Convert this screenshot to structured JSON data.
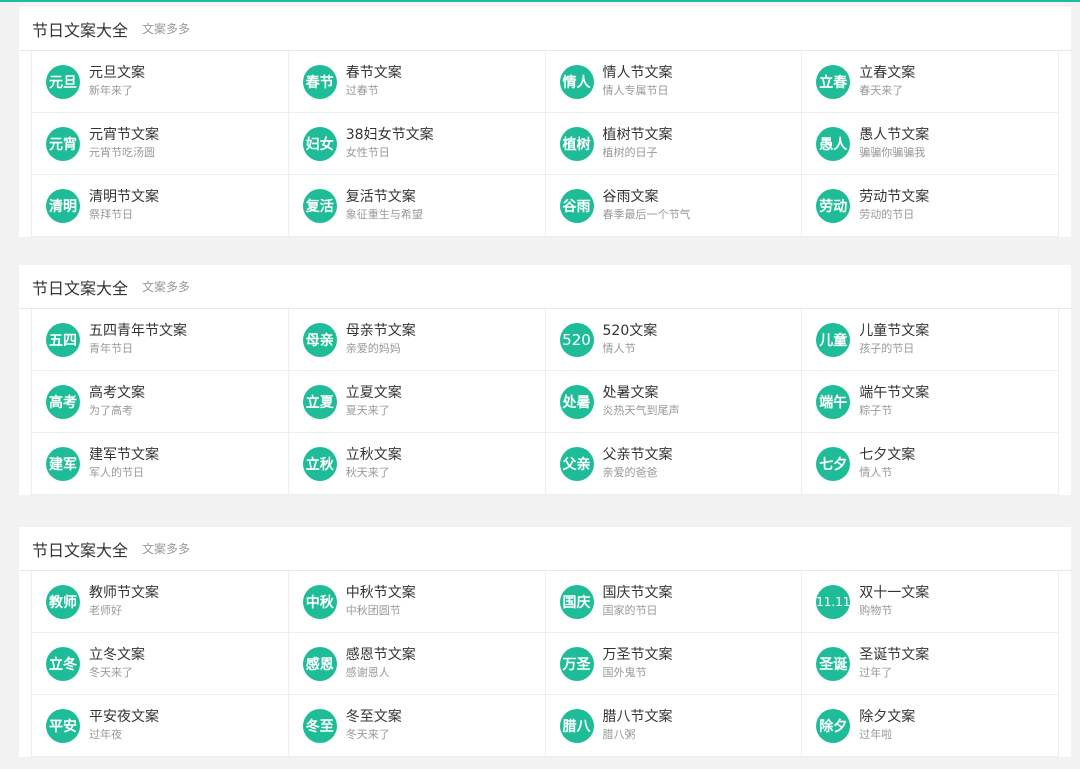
{
  "sections": [
    {
      "title": "节日文案大全",
      "subtitle": "文案多多",
      "items": [
        {
          "badge": "元旦",
          "name": "元旦文案",
          "desc": "新年来了"
        },
        {
          "badge": "春节",
          "name": "春节文案",
          "desc": "过春节"
        },
        {
          "badge": "情人",
          "name": "情人节文案",
          "desc": "情人专属节日"
        },
        {
          "badge": "立春",
          "name": "立春文案",
          "desc": "春天来了"
        },
        {
          "badge": "元宵",
          "name": "元宵节文案",
          "desc": "元宵节吃汤圆"
        },
        {
          "badge": "妇女",
          "name": "38妇女节文案",
          "desc": "女性节日"
        },
        {
          "badge": "植树",
          "name": "植树节文案",
          "desc": "植树的日子"
        },
        {
          "badge": "愚人",
          "name": "愚人节文案",
          "desc": "骗骗你骗骗我"
        },
        {
          "badge": "清明",
          "name": "清明节文案",
          "desc": "祭拜节日"
        },
        {
          "badge": "复活",
          "name": "复活节文案",
          "desc": "象征重生与希望"
        },
        {
          "badge": "谷雨",
          "name": "谷雨文案",
          "desc": "春季最后一个节气"
        },
        {
          "badge": "劳动",
          "name": "劳动节文案",
          "desc": "劳动的节日"
        }
      ]
    },
    {
      "title": "节日文案大全",
      "subtitle": "文案多多",
      "items": [
        {
          "badge": "五四",
          "name": "五四青年节文案",
          "desc": "青年节日"
        },
        {
          "badge": "母亲",
          "name": "母亲节文案",
          "desc": "亲爱的妈妈"
        },
        {
          "badge": "520",
          "name": "520文案",
          "desc": "情人节"
        },
        {
          "badge": "儿童",
          "name": "儿童节文案",
          "desc": "孩子的节日"
        },
        {
          "badge": "高考",
          "name": "高考文案",
          "desc": "为了高考"
        },
        {
          "badge": "立夏",
          "name": "立夏文案",
          "desc": "夏天来了"
        },
        {
          "badge": "处暑",
          "name": "处暑文案",
          "desc": "炎热天气到尾声"
        },
        {
          "badge": "端午",
          "name": "端午节文案",
          "desc": "粽子节"
        },
        {
          "badge": "建军",
          "name": "建军节文案",
          "desc": "军人的节日"
        },
        {
          "badge": "立秋",
          "name": "立秋文案",
          "desc": "秋天来了"
        },
        {
          "badge": "父亲",
          "name": "父亲节文案",
          "desc": "亲爱的爸爸"
        },
        {
          "badge": "七夕",
          "name": "七夕文案",
          "desc": "情人节"
        }
      ]
    },
    {
      "title": "节日文案大全",
      "subtitle": "文案多多",
      "items": [
        {
          "badge": "教师",
          "name": "教师节文案",
          "desc": "老师好"
        },
        {
          "badge": "中秋",
          "name": "中秋节文案",
          "desc": "中秋团圆节"
        },
        {
          "badge": "国庆",
          "name": "国庆节文案",
          "desc": "国家的节日"
        },
        {
          "badge": "11.11",
          "name": "双十一文案",
          "desc": "购物节"
        },
        {
          "badge": "立冬",
          "name": "立冬文案",
          "desc": "冬天来了"
        },
        {
          "badge": "感恩",
          "name": "感恩节文案",
          "desc": "感谢恩人"
        },
        {
          "badge": "万圣",
          "name": "万圣节文案",
          "desc": "国外鬼节"
        },
        {
          "badge": "圣诞",
          "name": "圣诞节文案",
          "desc": "过年了"
        },
        {
          "badge": "平安",
          "name": "平安夜文案",
          "desc": "过年夜"
        },
        {
          "badge": "冬至",
          "name": "冬至文案",
          "desc": "冬天来了"
        },
        {
          "badge": "腊八",
          "name": "腊八节文案",
          "desc": "腊八粥"
        },
        {
          "badge": "除夕",
          "name": "除夕文案",
          "desc": "过年啦"
        }
      ]
    }
  ],
  "colors": {
    "accent": "#1fbc98",
    "title": "#333333",
    "muted": "#999999"
  }
}
